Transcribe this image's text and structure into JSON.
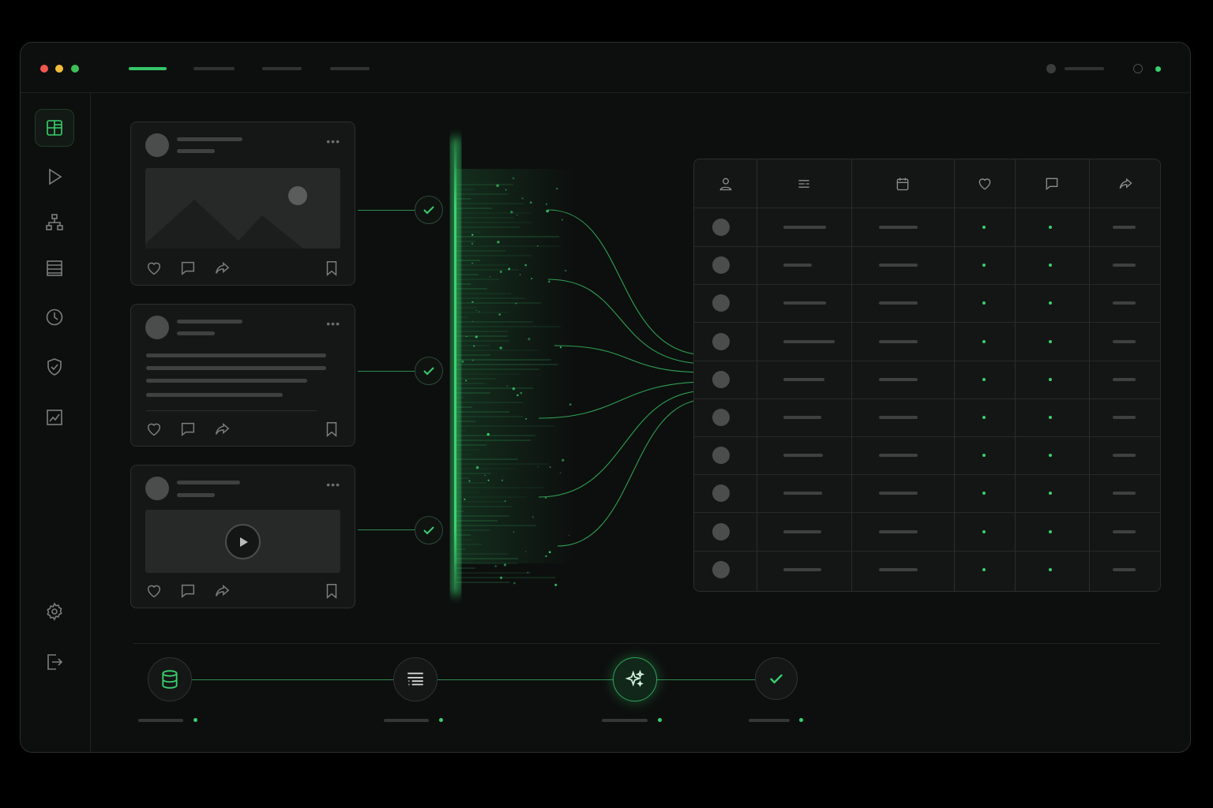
{
  "window": {
    "traffic_lights": [
      "#f0584f",
      "#f2bd3c",
      "#3fbf55"
    ],
    "accent": "#35c56a"
  },
  "topbar": {
    "tabs": [
      {
        "name": "tab-1",
        "active": true
      },
      {
        "name": "tab-2"
      },
      {
        "name": "tab-3"
      },
      {
        "name": "tab-4"
      }
    ],
    "status_dot_color": "#3ad06e"
  },
  "sidebar": {
    "items": [
      {
        "icon": "dashboard-icon",
        "active": true
      },
      {
        "icon": "play-icon"
      },
      {
        "icon": "hierarchy-icon"
      },
      {
        "icon": "list-icon"
      },
      {
        "icon": "clock-icon"
      },
      {
        "icon": "shield-check-icon"
      },
      {
        "icon": "chart-icon"
      },
      {
        "icon": "settings-icon"
      },
      {
        "icon": "logout-icon"
      }
    ]
  },
  "posts": [
    {
      "type": "image",
      "actions": [
        "heart-icon",
        "comment-icon",
        "share-icon",
        "bookmark-icon"
      ],
      "status": "check-icon"
    },
    {
      "type": "text",
      "actions": [
        "heart-icon",
        "comment-icon",
        "share-icon",
        "bookmark-icon"
      ],
      "status": "check-icon"
    },
    {
      "type": "video",
      "actions": [
        "heart-icon",
        "comment-icon",
        "share-icon",
        "bookmark-icon"
      ],
      "status": "check-icon"
    }
  ],
  "table": {
    "columns": [
      "user-icon",
      "text-icon",
      "calendar-icon",
      "heart-icon",
      "comment-icon",
      "share-icon"
    ],
    "row_count": 10
  },
  "pipeline": {
    "steps": [
      {
        "icon": "database-icon"
      },
      {
        "icon": "list-icon"
      },
      {
        "icon": "sparkles-icon",
        "active": true
      },
      {
        "icon": "check-icon"
      }
    ]
  }
}
